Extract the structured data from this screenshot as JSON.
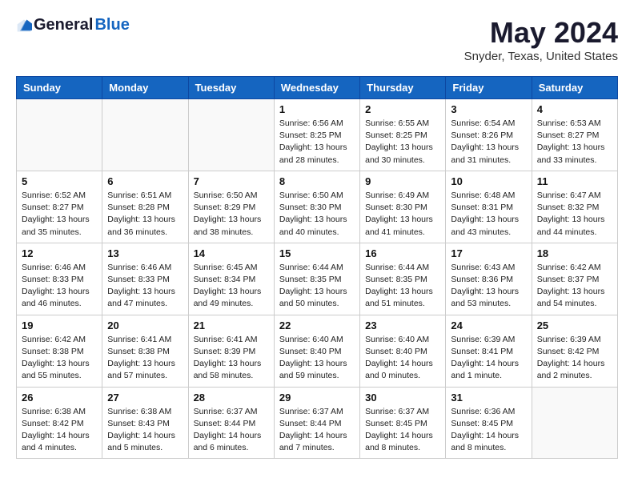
{
  "header": {
    "logo_general": "General",
    "logo_blue": "Blue",
    "month_title": "May 2024",
    "location": "Snyder, Texas, United States"
  },
  "days_of_week": [
    "Sunday",
    "Monday",
    "Tuesday",
    "Wednesday",
    "Thursday",
    "Friday",
    "Saturday"
  ],
  "weeks": [
    [
      {
        "day": "",
        "info": ""
      },
      {
        "day": "",
        "info": ""
      },
      {
        "day": "",
        "info": ""
      },
      {
        "day": "1",
        "info": "Sunrise: 6:56 AM\nSunset: 8:25 PM\nDaylight: 13 hours\nand 28 minutes."
      },
      {
        "day": "2",
        "info": "Sunrise: 6:55 AM\nSunset: 8:25 PM\nDaylight: 13 hours\nand 30 minutes."
      },
      {
        "day": "3",
        "info": "Sunrise: 6:54 AM\nSunset: 8:26 PM\nDaylight: 13 hours\nand 31 minutes."
      },
      {
        "day": "4",
        "info": "Sunrise: 6:53 AM\nSunset: 8:27 PM\nDaylight: 13 hours\nand 33 minutes."
      }
    ],
    [
      {
        "day": "5",
        "info": "Sunrise: 6:52 AM\nSunset: 8:27 PM\nDaylight: 13 hours\nand 35 minutes."
      },
      {
        "day": "6",
        "info": "Sunrise: 6:51 AM\nSunset: 8:28 PM\nDaylight: 13 hours\nand 36 minutes."
      },
      {
        "day": "7",
        "info": "Sunrise: 6:50 AM\nSunset: 8:29 PM\nDaylight: 13 hours\nand 38 minutes."
      },
      {
        "day": "8",
        "info": "Sunrise: 6:50 AM\nSunset: 8:30 PM\nDaylight: 13 hours\nand 40 minutes."
      },
      {
        "day": "9",
        "info": "Sunrise: 6:49 AM\nSunset: 8:30 PM\nDaylight: 13 hours\nand 41 minutes."
      },
      {
        "day": "10",
        "info": "Sunrise: 6:48 AM\nSunset: 8:31 PM\nDaylight: 13 hours\nand 43 minutes."
      },
      {
        "day": "11",
        "info": "Sunrise: 6:47 AM\nSunset: 8:32 PM\nDaylight: 13 hours\nand 44 minutes."
      }
    ],
    [
      {
        "day": "12",
        "info": "Sunrise: 6:46 AM\nSunset: 8:33 PM\nDaylight: 13 hours\nand 46 minutes."
      },
      {
        "day": "13",
        "info": "Sunrise: 6:46 AM\nSunset: 8:33 PM\nDaylight: 13 hours\nand 47 minutes."
      },
      {
        "day": "14",
        "info": "Sunrise: 6:45 AM\nSunset: 8:34 PM\nDaylight: 13 hours\nand 49 minutes."
      },
      {
        "day": "15",
        "info": "Sunrise: 6:44 AM\nSunset: 8:35 PM\nDaylight: 13 hours\nand 50 minutes."
      },
      {
        "day": "16",
        "info": "Sunrise: 6:44 AM\nSunset: 8:35 PM\nDaylight: 13 hours\nand 51 minutes."
      },
      {
        "day": "17",
        "info": "Sunrise: 6:43 AM\nSunset: 8:36 PM\nDaylight: 13 hours\nand 53 minutes."
      },
      {
        "day": "18",
        "info": "Sunrise: 6:42 AM\nSunset: 8:37 PM\nDaylight: 13 hours\nand 54 minutes."
      }
    ],
    [
      {
        "day": "19",
        "info": "Sunrise: 6:42 AM\nSunset: 8:38 PM\nDaylight: 13 hours\nand 55 minutes."
      },
      {
        "day": "20",
        "info": "Sunrise: 6:41 AM\nSunset: 8:38 PM\nDaylight: 13 hours\nand 57 minutes."
      },
      {
        "day": "21",
        "info": "Sunrise: 6:41 AM\nSunset: 8:39 PM\nDaylight: 13 hours\nand 58 minutes."
      },
      {
        "day": "22",
        "info": "Sunrise: 6:40 AM\nSunset: 8:40 PM\nDaylight: 13 hours\nand 59 minutes."
      },
      {
        "day": "23",
        "info": "Sunrise: 6:40 AM\nSunset: 8:40 PM\nDaylight: 14 hours\nand 0 minutes."
      },
      {
        "day": "24",
        "info": "Sunrise: 6:39 AM\nSunset: 8:41 PM\nDaylight: 14 hours\nand 1 minute."
      },
      {
        "day": "25",
        "info": "Sunrise: 6:39 AM\nSunset: 8:42 PM\nDaylight: 14 hours\nand 2 minutes."
      }
    ],
    [
      {
        "day": "26",
        "info": "Sunrise: 6:38 AM\nSunset: 8:42 PM\nDaylight: 14 hours\nand 4 minutes."
      },
      {
        "day": "27",
        "info": "Sunrise: 6:38 AM\nSunset: 8:43 PM\nDaylight: 14 hours\nand 5 minutes."
      },
      {
        "day": "28",
        "info": "Sunrise: 6:37 AM\nSunset: 8:44 PM\nDaylight: 14 hours\nand 6 minutes."
      },
      {
        "day": "29",
        "info": "Sunrise: 6:37 AM\nSunset: 8:44 PM\nDaylight: 14 hours\nand 7 minutes."
      },
      {
        "day": "30",
        "info": "Sunrise: 6:37 AM\nSunset: 8:45 PM\nDaylight: 14 hours\nand 8 minutes."
      },
      {
        "day": "31",
        "info": "Sunrise: 6:36 AM\nSunset: 8:45 PM\nDaylight: 14 hours\nand 8 minutes."
      },
      {
        "day": "",
        "info": ""
      }
    ]
  ]
}
